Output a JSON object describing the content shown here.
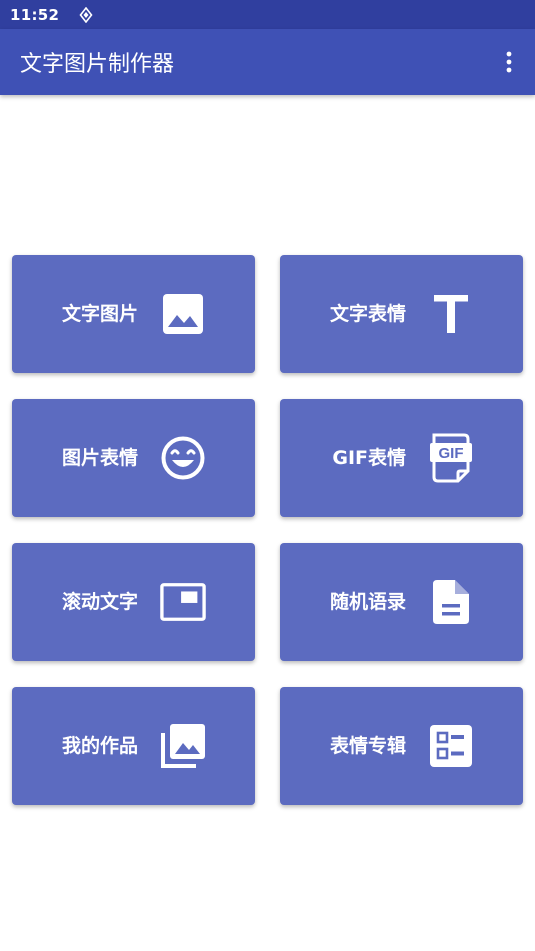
{
  "status_bar": {
    "time": "11:52",
    "background": "#303F9F"
  },
  "app_bar": {
    "title": "文字图片制作器",
    "background": "#3F51B5",
    "overflow_icon": "more-vert-icon"
  },
  "tile_color": "#5C6BC0",
  "tiles": [
    {
      "label": "文字图片",
      "icon": "image-icon"
    },
    {
      "label": "文字表情",
      "icon": "text-t-icon"
    },
    {
      "label": "图片表情",
      "icon": "smiley-face-icon"
    },
    {
      "label": "GIF表情",
      "icon": "gif-file-icon"
    },
    {
      "label": "滚动文字",
      "icon": "picture-in-picture-icon"
    },
    {
      "label": "随机语录",
      "icon": "document-icon"
    },
    {
      "label": "我的作品",
      "icon": "photo-library-icon"
    },
    {
      "label": "表情专辑",
      "icon": "checklist-icon"
    }
  ]
}
